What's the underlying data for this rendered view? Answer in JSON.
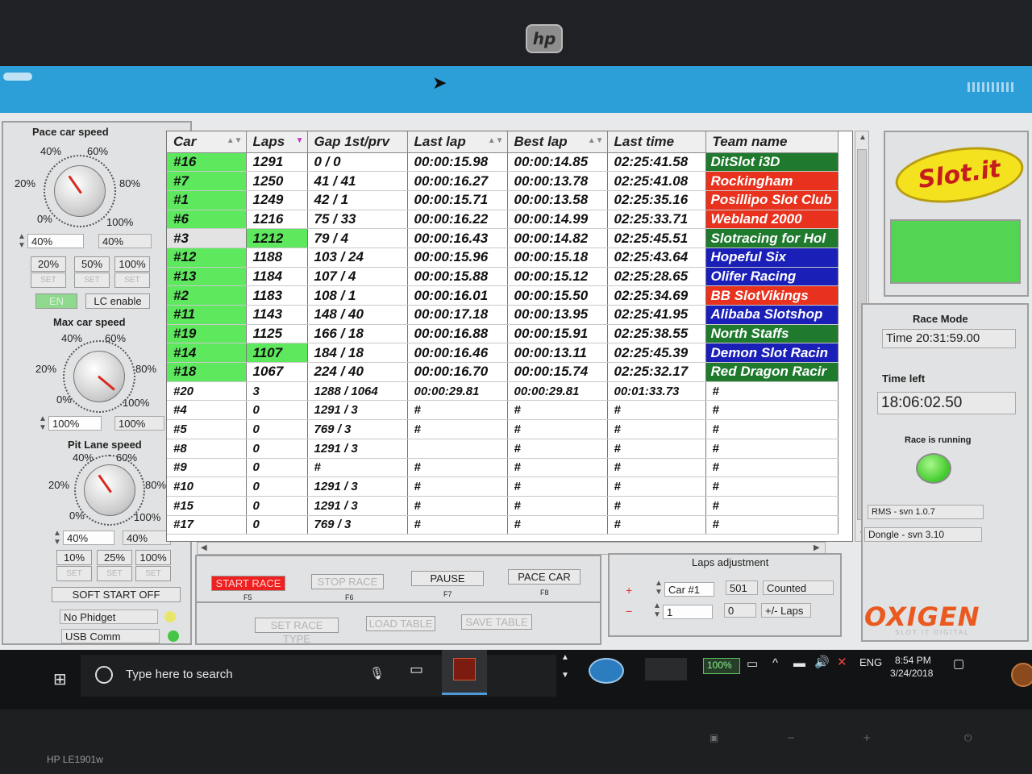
{
  "monitor": {
    "brand": "hp",
    "model": "HP LE1901w"
  },
  "pace_car": {
    "title": "Pace car speed",
    "scale": [
      "40%",
      "60%",
      "20%",
      "80%",
      "0%",
      "100%"
    ],
    "input": "40%",
    "value": "40%",
    "presets": [
      "20%",
      "50%",
      "100%"
    ],
    "set_label": "SET",
    "en_label": "EN",
    "lc_label": "LC enable"
  },
  "max_car": {
    "title": "Max car speed",
    "scale": [
      "40%",
      "60%",
      "20%",
      "80%",
      "0%",
      "100%"
    ],
    "input": "100%",
    "value": "100%"
  },
  "pit_lane": {
    "title": "Pit Lane speed",
    "scale": [
      "40%",
      "60%",
      "20%",
      "80%",
      "0%",
      "100%"
    ],
    "input": "40%",
    "value": "40%",
    "presets": [
      "10%",
      "25%",
      "100%"
    ],
    "set_label": "SET"
  },
  "soft_start": "SOFT START OFF",
  "status": {
    "phidget": "No Phidget",
    "usb": "USB Comm"
  },
  "table": {
    "headers": [
      "Car",
      "Laps",
      "Gap 1st/prv",
      "Last lap",
      "Best lap",
      "Last time",
      "Team name"
    ],
    "rows": [
      {
        "car": "#16",
        "laps": "1291",
        "gap": "0 / 0",
        "last": "00:00:15.98",
        "best": "00:00:14.85",
        "time": "02:25:41.58",
        "team": "DitSlot i3D",
        "car_bg": "#5ee85e",
        "laps_bg": "",
        "team_bg": "#1f7a2e"
      },
      {
        "car": "#7",
        "laps": "1250",
        "gap": "41 / 41",
        "last": "00:00:16.27",
        "best": "00:00:13.78",
        "time": "02:25:41.08",
        "team": "Rockingham",
        "car_bg": "#5ee85e",
        "laps_bg": "",
        "team_bg": "#e8321e"
      },
      {
        "car": "#1",
        "laps": "1249",
        "gap": "42 / 1",
        "last": "00:00:15.71",
        "best": "00:00:13.58",
        "time": "02:25:35.16",
        "team": "Posillipo Slot Club",
        "car_bg": "#5ee85e",
        "laps_bg": "",
        "team_bg": "#e8321e"
      },
      {
        "car": "#6",
        "laps": "1216",
        "gap": "75 / 33",
        "last": "00:00:16.22",
        "best": "00:00:14.99",
        "time": "02:25:33.71",
        "team": "Webland 2000",
        "car_bg": "#5ee85e",
        "laps_bg": "",
        "team_bg": "#e8321e"
      },
      {
        "car": "#3",
        "laps": "1212",
        "gap": "79 / 4",
        "last": "00:00:16.43",
        "best": "00:00:14.82",
        "time": "02:25:45.51",
        "team": "Slotracing for Hol",
        "car_bg": "#e3e3e3",
        "laps_bg": "#5ee85e",
        "team_bg": "#1f7a2e"
      },
      {
        "car": "#12",
        "laps": "1188",
        "gap": "103 / 24",
        "last": "00:00:15.96",
        "best": "00:00:15.18",
        "time": "02:25:43.64",
        "team": "Hopeful Six",
        "car_bg": "#5ee85e",
        "laps_bg": "",
        "team_bg": "#1a1fb8"
      },
      {
        "car": "#13",
        "laps": "1184",
        "gap": "107 / 4",
        "last": "00:00:15.88",
        "best": "00:00:15.12",
        "time": "02:25:28.65",
        "team": "Olifer Racing",
        "car_bg": "#5ee85e",
        "laps_bg": "",
        "team_bg": "#1a1fb8"
      },
      {
        "car": "#2",
        "laps": "1183",
        "gap": "108 / 1",
        "last": "00:00:16.01",
        "best": "00:00:15.50",
        "time": "02:25:34.69",
        "team": "BB SlotVikings",
        "car_bg": "#5ee85e",
        "laps_bg": "",
        "team_bg": "#e8321e"
      },
      {
        "car": "#11",
        "laps": "1143",
        "gap": "148 / 40",
        "last": "00:00:17.18",
        "best": "00:00:13.95",
        "time": "02:25:41.95",
        "team": "Alibaba Slotshop",
        "car_bg": "#5ee85e",
        "laps_bg": "",
        "team_bg": "#1a1fb8"
      },
      {
        "car": "#19",
        "laps": "1125",
        "gap": "166 / 18",
        "last": "00:00:16.88",
        "best": "00:00:15.91",
        "time": "02:25:38.55",
        "team": "North Staffs",
        "car_bg": "#5ee85e",
        "laps_bg": "",
        "team_bg": "#1f7a2e"
      },
      {
        "car": "#14",
        "laps": "1107",
        "gap": "184 / 18",
        "last": "00:00:16.46",
        "best": "00:00:13.11",
        "time": "02:25:45.39",
        "team": "Demon Slot Racin",
        "car_bg": "#5ee85e",
        "laps_bg": "#5ee85e",
        "team_bg": "#1a1fb8"
      },
      {
        "car": "#18",
        "laps": "1067",
        "gap": "224 / 40",
        "last": "00:00:16.70",
        "best": "00:00:15.74",
        "time": "02:25:32.17",
        "team": "Red Dragon Racir",
        "car_bg": "#5ee85e",
        "laps_bg": "",
        "team_bg": "#1f7a2e"
      },
      {
        "car": "#20",
        "laps": "3",
        "gap": "1288 / 1064",
        "last": "00:00:29.81",
        "best": "00:00:29.81",
        "time": "00:01:33.73",
        "team": "#",
        "car_bg": "",
        "laps_bg": "",
        "team_bg": ""
      },
      {
        "car": "#4",
        "laps": "0",
        "gap": "1291 / 3",
        "last": "#",
        "best": "#",
        "time": "#",
        "team": "#",
        "car_bg": "",
        "laps_bg": "",
        "team_bg": ""
      },
      {
        "car": "#5",
        "laps": "0",
        "gap": "769 / 3",
        "last": "#",
        "best": "#",
        "time": "#",
        "team": "#",
        "car_bg": "",
        "laps_bg": "",
        "team_bg": ""
      },
      {
        "car": "#8",
        "laps": "0",
        "gap": "1291 / 3",
        "last": "",
        "best": "#",
        "time": "#",
        "team": "#",
        "car_bg": "",
        "laps_bg": "",
        "team_bg": ""
      },
      {
        "car": "#9",
        "laps": "0",
        "gap": "#",
        "last": "#",
        "best": "#",
        "time": "#",
        "team": "#",
        "car_bg": "",
        "laps_bg": "",
        "team_bg": ""
      },
      {
        "car": "#10",
        "laps": "0",
        "gap": "1291 / 3",
        "last": "#",
        "best": "#",
        "time": "#",
        "team": "#",
        "car_bg": "",
        "laps_bg": "",
        "team_bg": ""
      },
      {
        "car": "#15",
        "laps": "0",
        "gap": "1291 / 3",
        "last": "#",
        "best": "#",
        "time": "#",
        "team": "#",
        "car_bg": "",
        "laps_bg": "",
        "team_bg": ""
      },
      {
        "car": "#17",
        "laps": "0",
        "gap": "769 / 3",
        "last": "#",
        "best": "#",
        "time": "#",
        "team": "#",
        "car_bg": "",
        "laps_bg": "",
        "team_bg": ""
      }
    ]
  },
  "controls": {
    "start": "START RACE",
    "start_key": "F5",
    "stop": "STOP RACE",
    "stop_key": "F6",
    "pause": "PAUSE",
    "pause_key": "F7",
    "pace": "PACE CAR",
    "pace_key": "F8",
    "set_race_type": "SET RACE TYPE",
    "load_table": "LOAD TABLE",
    "save_table": "SAVE TABLE"
  },
  "laps_adjust": {
    "title": "Laps adjustment",
    "car": "Car #1",
    "counted_value": "501",
    "counted_label": "Counted Laps",
    "step": "1",
    "delta_value": "0",
    "delta_label": "+/- Laps"
  },
  "right": {
    "logo": "Slot.it",
    "race_mode_label": "Race Mode",
    "race_mode_value": "Time 20:31:59.00",
    "time_left_label": "Time left",
    "time_left_value": "18:06:02.50",
    "running_label": "Race is running",
    "rms": "RMS - svn 1.0.7",
    "dongle": "Dongle - svn 3.10",
    "brand": "OXIGEN",
    "brand_sub": "SLOT IT DIGITAL"
  },
  "taskbar": {
    "search": "Type here to search",
    "battery": "100%",
    "lang": "ENG",
    "time": "8:54 PM",
    "date": "3/24/2018"
  }
}
